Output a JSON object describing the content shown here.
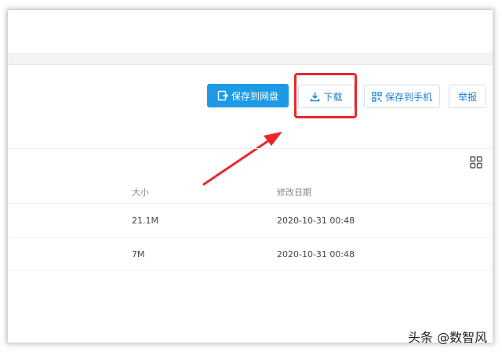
{
  "toolbar": {
    "save_to_disk": "保存到网盘",
    "download": "下载",
    "save_to_phone": "保存到手机",
    "report": "举报"
  },
  "table": {
    "columns": [
      "大小",
      "修改日期"
    ],
    "rows": [
      {
        "size": "21.1M",
        "modified": "2020-10-31 00:48"
      },
      {
        "size": "7M",
        "modified": "2020-10-31 00:48"
      }
    ]
  },
  "annotations": {
    "highlight_color": "#e8282b"
  },
  "watermark": "头条 @数智风",
  "icons": {
    "save": "save-disk-icon",
    "download": "download-icon",
    "qr": "qr-code-icon",
    "view": "grid-view-icon"
  }
}
